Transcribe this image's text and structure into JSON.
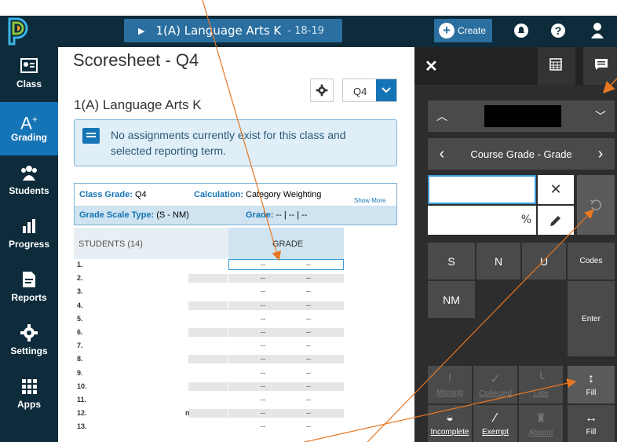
{
  "header": {
    "class_label": "1(A) Language Arts K",
    "year": "18-19",
    "create_label": "Create",
    "icons": [
      "bell-icon",
      "help-icon",
      "user-icon"
    ]
  },
  "sidebar": {
    "items": [
      {
        "label": "Class",
        "icon": "class-icon"
      },
      {
        "label": "Grading",
        "icon": "grading-icon",
        "active": true
      },
      {
        "label": "Students",
        "icon": "students-icon"
      },
      {
        "label": "Progress",
        "icon": "progress-icon"
      },
      {
        "label": "Reports",
        "icon": "reports-icon"
      },
      {
        "label": "Settings",
        "icon": "settings-icon"
      },
      {
        "label": "Apps",
        "icon": "apps-icon"
      }
    ]
  },
  "main": {
    "title": "Scoresheet - Q4",
    "term": "Q4",
    "class_name": "1(A) Language Arts K",
    "notice": "No assignments currently exist for this class and selected reporting term.",
    "info": {
      "class_grade_label": "Class Grade:",
      "class_grade_value": "Q4",
      "calculation_label": "Calculation:",
      "calculation_value": "Category Weighting",
      "show_more": "Show More",
      "scale_label": "Grade Scale Type:",
      "scale_value": "(S - NM)",
      "grade_label": "Grade:",
      "grade_value": "-- | -- | --"
    },
    "table": {
      "students_header": "STUDENTS (14)",
      "grade_header": "GRADE",
      "rows": [
        "1.",
        "2.",
        "3.",
        "4.",
        "5.",
        "6.",
        "7.",
        "8.",
        "9.",
        "10.",
        "11.",
        "12.",
        "13."
      ],
      "grade_placeholder": "--",
      "row12_suffix": "n"
    }
  },
  "panel": {
    "course_grade": "Course Grade - Grade",
    "percent": "%",
    "grade_buttons": [
      "S",
      "N",
      "U"
    ],
    "codes": "Codes",
    "nm": "NM",
    "enter": "Enter",
    "flags": [
      "Missing",
      "Collected",
      "Late",
      "Fill"
    ],
    "flags2": [
      "Incomplete",
      "Exempt",
      "Absent",
      "Fill"
    ]
  },
  "colors": {
    "navy": "#0d2b3a",
    "accent": "#1574b5",
    "arrow": "#e87722"
  }
}
